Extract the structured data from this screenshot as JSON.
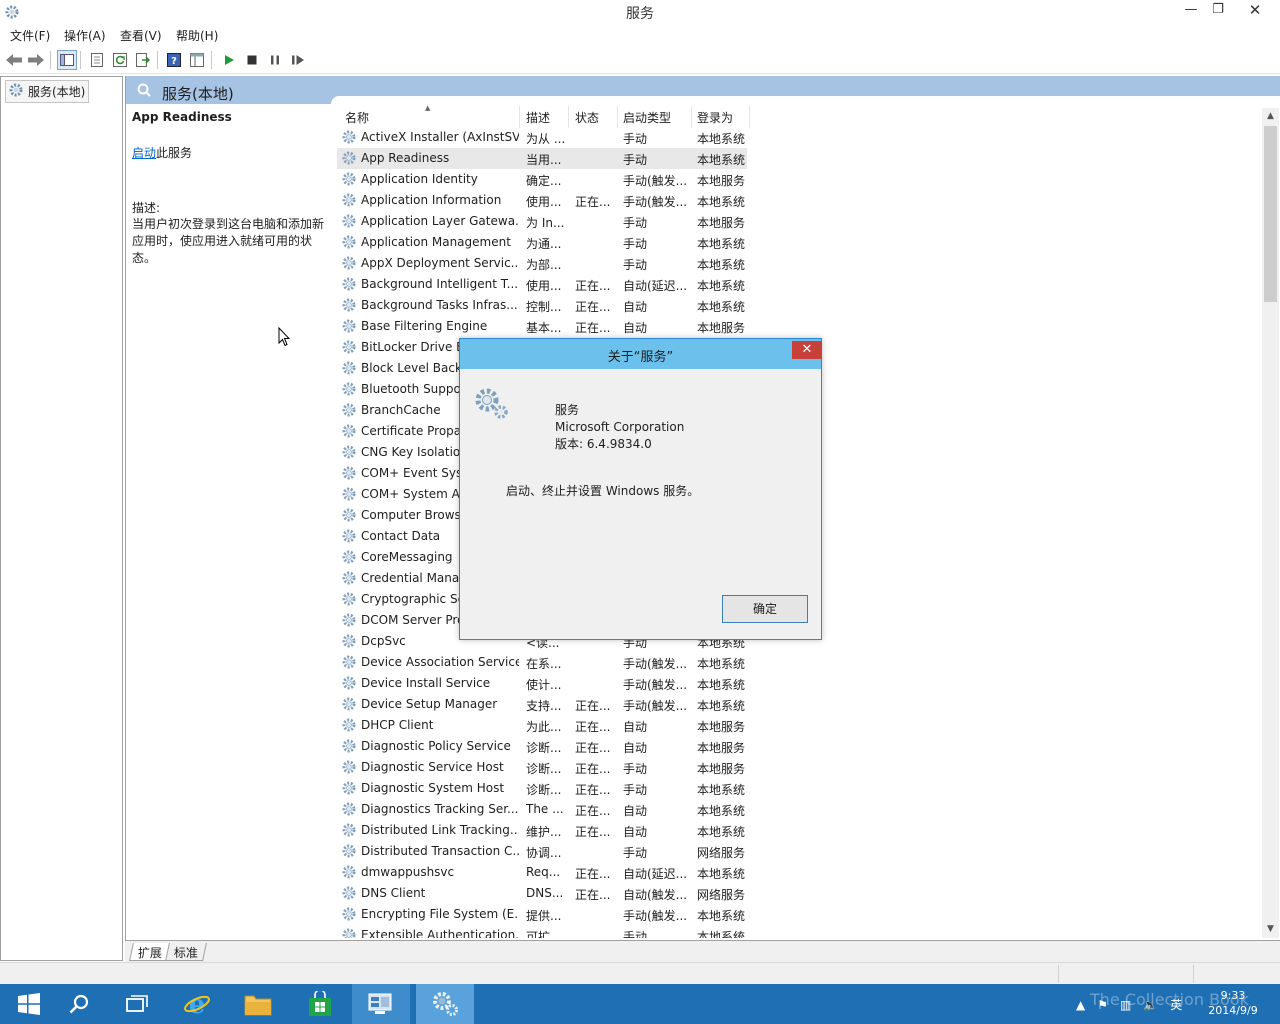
{
  "window": {
    "title": "服务",
    "minimize_glyph": "—",
    "maximize_glyph": "❐",
    "close_glyph": "✕"
  },
  "menu": [
    {
      "label": "文件(F)"
    },
    {
      "label": "操作(A)"
    },
    {
      "label": "查看(V)"
    },
    {
      "label": "帮助(H)"
    }
  ],
  "tree": {
    "root_label": "服务(本地)"
  },
  "content": {
    "header_title": "服务(本地)",
    "selected_service": "App Readiness",
    "start_link": "启动",
    "start_suffix": "此服务",
    "desc_label": "描述:",
    "desc_text": "当用户初次登录到这台电脑和添加新应用时，使应用进入就绪可用的状态。"
  },
  "columns": {
    "name": "名称",
    "description": "描述",
    "status": "状态",
    "startup": "启动类型",
    "logon": "登录为"
  },
  "services": [
    {
      "name": "ActiveX Installer (AxInstSV)",
      "desc": "为从 ...",
      "status": "",
      "startup": "手动",
      "logon": "本地系统"
    },
    {
      "name": "App Readiness",
      "desc": "当用...",
      "status": "",
      "startup": "手动",
      "logon": "本地系统"
    },
    {
      "name": "Application Identity",
      "desc": "确定...",
      "status": "",
      "startup": "手动(触发...",
      "logon": "本地服务"
    },
    {
      "name": "Application Information",
      "desc": "使用...",
      "status": "正在...",
      "startup": "手动(触发...",
      "logon": "本地系统"
    },
    {
      "name": "Application Layer Gatewa...",
      "desc": "为 In...",
      "status": "",
      "startup": "手动",
      "logon": "本地服务"
    },
    {
      "name": "Application Management",
      "desc": "为通...",
      "status": "",
      "startup": "手动",
      "logon": "本地系统"
    },
    {
      "name": "AppX Deployment Servic...",
      "desc": "为部...",
      "status": "",
      "startup": "手动",
      "logon": "本地系统"
    },
    {
      "name": "Background Intelligent T...",
      "desc": "使用...",
      "status": "正在...",
      "startup": "自动(延迟...",
      "logon": "本地系统"
    },
    {
      "name": "Background Tasks Infras...",
      "desc": "控制...",
      "status": "正在...",
      "startup": "自动",
      "logon": "本地系统"
    },
    {
      "name": "Base Filtering Engine",
      "desc": "基本...",
      "status": "正在...",
      "startup": "自动",
      "logon": "本地服务"
    },
    {
      "name": "BitLocker Drive E",
      "desc": "",
      "status": "",
      "startup": "",
      "logon": ""
    },
    {
      "name": "Block Level Back",
      "desc": "",
      "status": "",
      "startup": "",
      "logon": ""
    },
    {
      "name": "Bluetooth Suppo",
      "desc": "",
      "status": "",
      "startup": "",
      "logon": ""
    },
    {
      "name": "BranchCache",
      "desc": "",
      "status": "",
      "startup": "",
      "logon": ""
    },
    {
      "name": "Certificate Propa",
      "desc": "",
      "status": "",
      "startup": "",
      "logon": ""
    },
    {
      "name": "CNG Key Isolatio",
      "desc": "",
      "status": "",
      "startup": "",
      "logon": ""
    },
    {
      "name": "COM+ Event Sys",
      "desc": "",
      "status": "",
      "startup": "",
      "logon": ""
    },
    {
      "name": "COM+ System A",
      "desc": "",
      "status": "",
      "startup": "",
      "logon": ""
    },
    {
      "name": "Computer Brows",
      "desc": "",
      "status": "",
      "startup": "",
      "logon": ""
    },
    {
      "name": "Contact Data",
      "desc": "",
      "status": "",
      "startup": "",
      "logon": ""
    },
    {
      "name": "CoreMessaging",
      "desc": "",
      "status": "",
      "startup": "",
      "logon": ""
    },
    {
      "name": "Credential Mana",
      "desc": "",
      "status": "",
      "startup": "",
      "logon": ""
    },
    {
      "name": "Cryptographic Se",
      "desc": "",
      "status": "",
      "startup": "",
      "logon": ""
    },
    {
      "name": "DCOM Server Pro",
      "desc": "",
      "status": "",
      "startup": "",
      "logon": ""
    },
    {
      "name": "DcpSvc",
      "desc": "<读...",
      "status": "",
      "startup": "手动",
      "logon": "本地系统"
    },
    {
      "name": "Device Association Service",
      "desc": "在系...",
      "status": "",
      "startup": "手动(触发...",
      "logon": "本地系统"
    },
    {
      "name": "Device Install Service",
      "desc": "使计...",
      "status": "",
      "startup": "手动(触发...",
      "logon": "本地系统"
    },
    {
      "name": "Device Setup Manager",
      "desc": "支持...",
      "status": "正在...",
      "startup": "手动(触发...",
      "logon": "本地系统"
    },
    {
      "name": "DHCP Client",
      "desc": "为此...",
      "status": "正在...",
      "startup": "自动",
      "logon": "本地服务"
    },
    {
      "name": "Diagnostic Policy Service",
      "desc": "诊断...",
      "status": "正在...",
      "startup": "自动",
      "logon": "本地服务"
    },
    {
      "name": "Diagnostic Service Host",
      "desc": "诊断...",
      "status": "正在...",
      "startup": "手动",
      "logon": "本地服务"
    },
    {
      "name": "Diagnostic System Host",
      "desc": "诊断...",
      "status": "正在...",
      "startup": "手动",
      "logon": "本地系统"
    },
    {
      "name": "Diagnostics Tracking Ser...",
      "desc": "The ...",
      "status": "正在...",
      "startup": "自动",
      "logon": "本地系统"
    },
    {
      "name": "Distributed Link Tracking...",
      "desc": "维护...",
      "status": "正在...",
      "startup": "自动",
      "logon": "本地系统"
    },
    {
      "name": "Distributed Transaction C...",
      "desc": "协调...",
      "status": "",
      "startup": "手动",
      "logon": "网络服务"
    },
    {
      "name": "dmwappushsvc",
      "desc": "Req...",
      "status": "正在...",
      "startup": "自动(延迟...",
      "logon": "本地系统"
    },
    {
      "name": "DNS Client",
      "desc": "DNS...",
      "status": "正在...",
      "startup": "自动(触发...",
      "logon": "网络服务"
    },
    {
      "name": "Encrypting File System (E...",
      "desc": "提供...",
      "status": "",
      "startup": "手动(触发...",
      "logon": "本地系统"
    },
    {
      "name": "Extensible Authentication...",
      "desc": "可扩...",
      "status": "",
      "startup": "手动",
      "logon": "本地系统"
    }
  ],
  "bottom_tabs": [
    "扩展",
    "标准"
  ],
  "dialog": {
    "title": "关于“服务”",
    "app_name": "服务",
    "company": "Microsoft Corporation",
    "version": "版本: 6.4.9834.0",
    "summary": "启动、终止并设置 Windows 服务。",
    "ok_label": "确定",
    "close_glyph": "✕"
  },
  "taskbar": {
    "tray_lang": "英",
    "clock_time": "9:33",
    "clock_date": "2014/9/9",
    "watermark": "The Collection Book"
  },
  "colors": {
    "header_blue": "#a6c3e3",
    "dialog_title": "#6cc0ec",
    "taskbar": "#1e6fb3",
    "close_red": "#c7413a",
    "link": "#0066cc"
  }
}
